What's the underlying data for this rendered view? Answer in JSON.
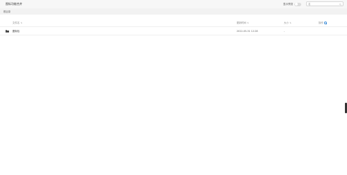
{
  "header": {
    "title": "图标功能合并",
    "preview_label": "显示预览",
    "search": {
      "value": "",
      "placeholder": "名"
    }
  },
  "breadcrumb": "根目录",
  "table": {
    "columns": [
      {
        "key": "name",
        "label": "文件名"
      },
      {
        "key": "modified",
        "label": "更新时间"
      },
      {
        "key": "size",
        "label": "大小"
      },
      {
        "key": "action",
        "label": "操作"
      }
    ],
    "rows": [
      {
        "icon": "folder-icon",
        "name": "图标包",
        "modified": "2022-05-31 12:28",
        "size": "-"
      }
    ]
  },
  "colors": {
    "accent": "#3f8ed8",
    "header_bg": "#f7f7f7",
    "band_bg": "#f2f2f2"
  }
}
